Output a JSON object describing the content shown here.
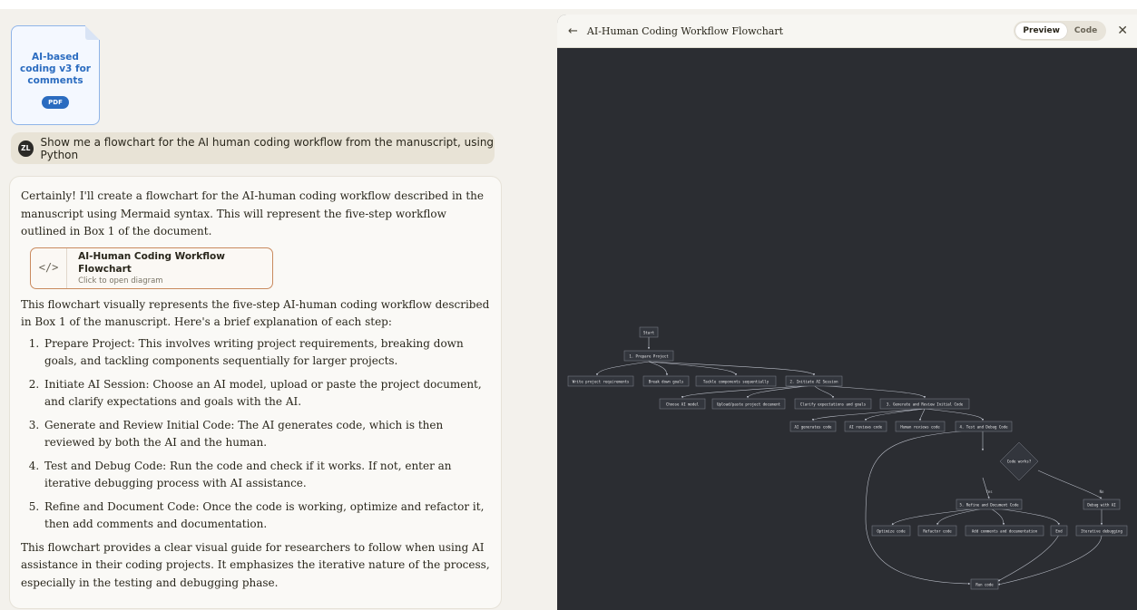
{
  "attachment": {
    "title": "AI-based coding v3 for comments",
    "badge": "PDF"
  },
  "user": {
    "initials": "ZL",
    "message": "Show me a flowchart for the AI human coding workflow from the manuscript, using Python"
  },
  "assistant": {
    "intro": "Certainly! I'll create a flowchart for the AI-human coding workflow described in the manuscript using Mermaid syntax. This will represent the five-step workflow outlined in Box 1 of the document.",
    "artifact": {
      "icon": "</>",
      "title": "AI-Human Coding Workflow Flowchart",
      "subtitle": "Click to open diagram"
    },
    "explanation": "This flowchart visually represents the five-step AI-human coding workflow described in Box 1 of the manuscript. Here's a brief explanation of each step:",
    "steps": [
      "Prepare Project: This involves writing project requirements, breaking down goals, and tackling components sequentially for larger projects.",
      "Initiate AI Session: Choose an AI model, upload or paste the project document, and clarify expectations and goals with the AI.",
      "Generate and Review Initial Code: The AI generates code, which is then reviewed by both the AI and the human.",
      "Test and Debug Code: Run the code and check if it works. If not, enter an iterative debugging process with AI assistance.",
      "Refine and Document Code: Once the code is working, optimize and refactor it, then add comments and documentation."
    ],
    "conclusion": "This flowchart provides a clear visual guide for researchers to follow when using AI assistance in their coding projects. It emphasizes the iterative nature of the process, especially in the testing and debugging phase."
  },
  "panel": {
    "back_icon": "←",
    "title": "AI-Human Coding Workflow Flowchart",
    "tab_preview": "Preview",
    "tab_code": "Code",
    "close_icon": "✕"
  },
  "diagram": {
    "start": "Start",
    "prepare": "1. Prepare Project",
    "write_req": "Write project requirements",
    "break_goals": "Break down goals",
    "tackle": "Tackle components sequentially",
    "initiate": "2. Initiate AI Session",
    "choose_model": "Choose AI model",
    "upload": "Upload/paste project document",
    "clarify": "Clarify expectations and goals",
    "generate": "3. Generate and Review Initial Code",
    "ai_generates": "AI generates code",
    "ai_reviews": "AI reviews code",
    "human_reviews": "Human reviews code",
    "test": "4. Test and Debug Code",
    "decision": "Code works?",
    "yes": "Yes",
    "no": "No",
    "refine": "5. Refine and Document Code",
    "debug_ai": "Debug with AI",
    "optimize": "Optimize code",
    "refactor": "Refactor code",
    "comments": "Add comments and documentation",
    "end": "End",
    "iterative": "Iterative debugging",
    "run": "Run code"
  }
}
